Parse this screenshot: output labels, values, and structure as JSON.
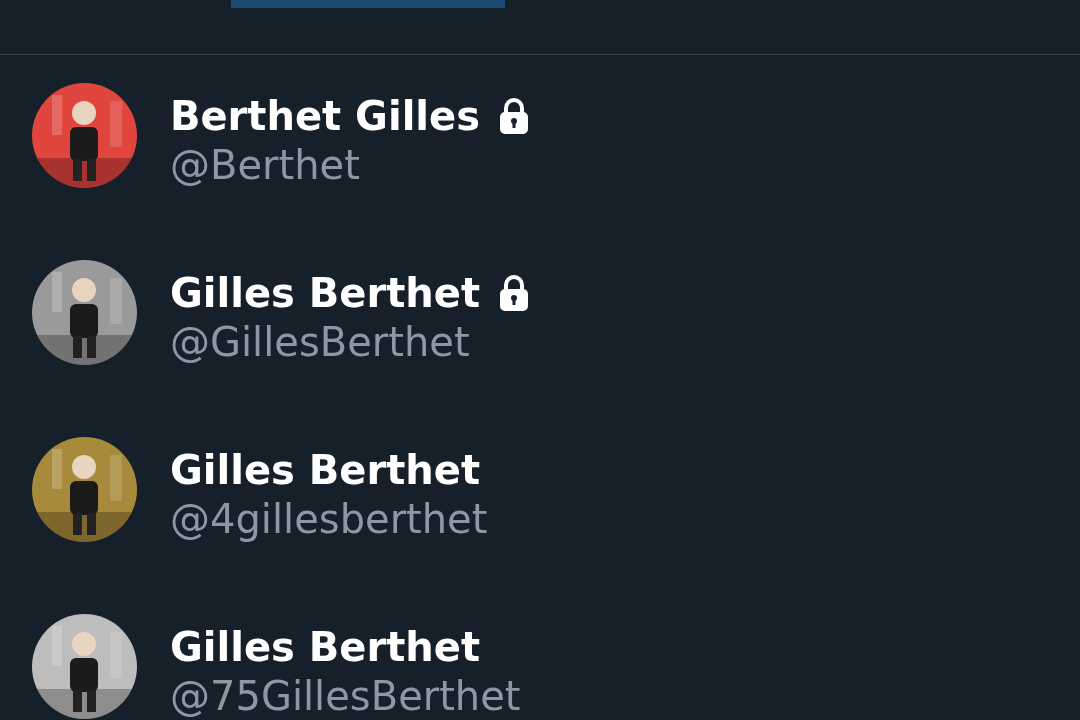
{
  "users": [
    {
      "name": "Berthet Gilles",
      "handle": "@Berthet",
      "protected": true
    },
    {
      "name": "Gilles Berthet",
      "handle": "@GillesBerthet",
      "protected": true
    },
    {
      "name": "Gilles Berthet",
      "handle": "@4gillesberthet",
      "protected": false
    },
    {
      "name": "Gilles Berthet",
      "handle": "@75GillesBerthet",
      "protected": false
    }
  ]
}
